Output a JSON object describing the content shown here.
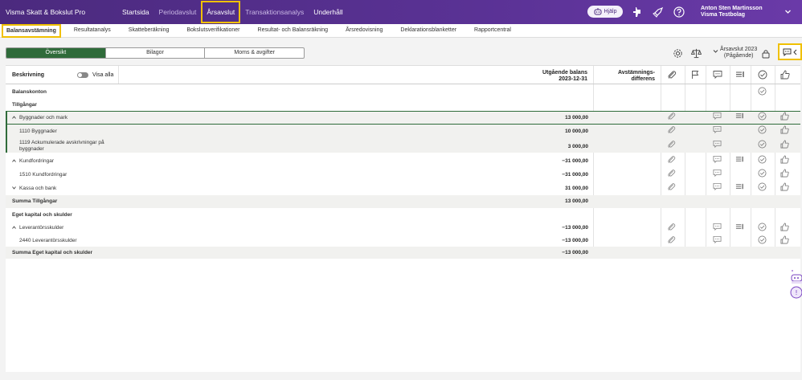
{
  "app": {
    "title": "Visma Skatt & Bokslut Pro"
  },
  "topnav": [
    {
      "label": "Startsida",
      "state": "normal"
    },
    {
      "label": "Periodavslut",
      "state": "dim"
    },
    {
      "label": "Årsavslut",
      "state": "active"
    },
    {
      "label": "Transaktionsanalys",
      "state": "dim"
    },
    {
      "label": "Underhåll",
      "state": "normal"
    }
  ],
  "help": {
    "label": "Hjälp"
  },
  "user": {
    "name": "Anton Sten Martinsson",
    "company": "Visma Testbolag"
  },
  "subtabs": [
    {
      "label": "Balansavstämning",
      "active": true
    },
    {
      "label": "Resultatanalys",
      "active": false
    },
    {
      "label": "Skatteberäkning",
      "active": false
    },
    {
      "label": "Bokslutsverifikationer",
      "active": false
    },
    {
      "label": "Resultat- och Balansräkning",
      "active": false
    },
    {
      "label": "Årsredovisning",
      "active": false
    },
    {
      "label": "Deklarationsblanketter",
      "active": false
    },
    {
      "label": "Rapportcentral",
      "active": false
    }
  ],
  "segments": [
    {
      "label": "Översikt",
      "active": true
    },
    {
      "label": "Bilagor",
      "active": false
    },
    {
      "label": "Moms & avgifter",
      "active": false
    }
  ],
  "period": {
    "line1": "Årsavslut 2023",
    "line2": "(Pågående)"
  },
  "table": {
    "header": {
      "description": "Beskrivning",
      "show_all": "Visa alla",
      "balance_line1": "Utgående balans",
      "balance_line2": "2023-12-31",
      "diff_line1": "Avstämnings-",
      "diff_line2": "differens"
    },
    "rows": [
      {
        "label": "Balanskonton",
        "amount": ""
      },
      {
        "label": "Tillgångar",
        "amount": ""
      },
      {
        "label": "Byggnader och mark",
        "amount": "13 000,00"
      },
      {
        "label": "1110 Byggnader",
        "amount": "10 000,00"
      },
      {
        "label": "1119 Ackumulerade avskrivningar på byggnader",
        "amount": "3 000,00"
      },
      {
        "label": "Kundfordringar",
        "amount": "−31 000,00"
      },
      {
        "label": "1510 Kundfordringar",
        "amount": "−31 000,00"
      },
      {
        "label": "Kassa och bank",
        "amount": "31 000,00"
      },
      {
        "label": "Summa Tillgångar",
        "amount": "13 000,00"
      },
      {
        "label": "Eget kapital och skulder",
        "amount": ""
      },
      {
        "label": "Leverantörsskulder",
        "amount": "−13 000,00"
      },
      {
        "label": "2440 Leverantörsskulder",
        "amount": "−13 000,00"
      },
      {
        "label": "Summa Eget kapital och skulder",
        "amount": "−13 000,00"
      }
    ]
  }
}
